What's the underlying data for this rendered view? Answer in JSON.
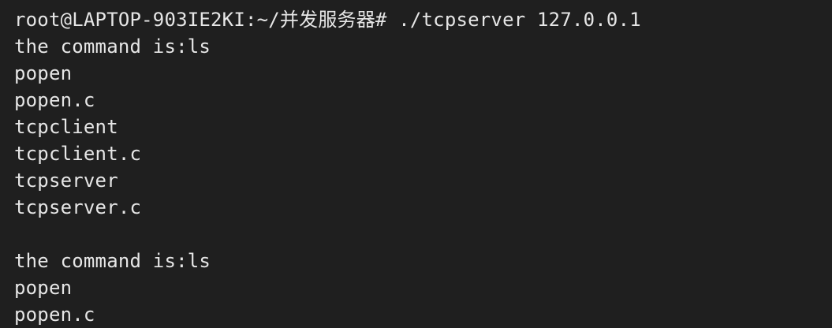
{
  "terminal": {
    "background": "#1f1f1f",
    "foreground": "#e6e6e6",
    "lines": [
      "root@LAPTOP-903IE2KI:~/并发服务器# ./tcpserver 127.0.0.1",
      "the command is:ls",
      "popen",
      "popen.c",
      "tcpclient",
      "tcpclient.c",
      "tcpserver",
      "tcpserver.c",
      "",
      "the command is:ls",
      "popen",
      "popen.c"
    ]
  }
}
